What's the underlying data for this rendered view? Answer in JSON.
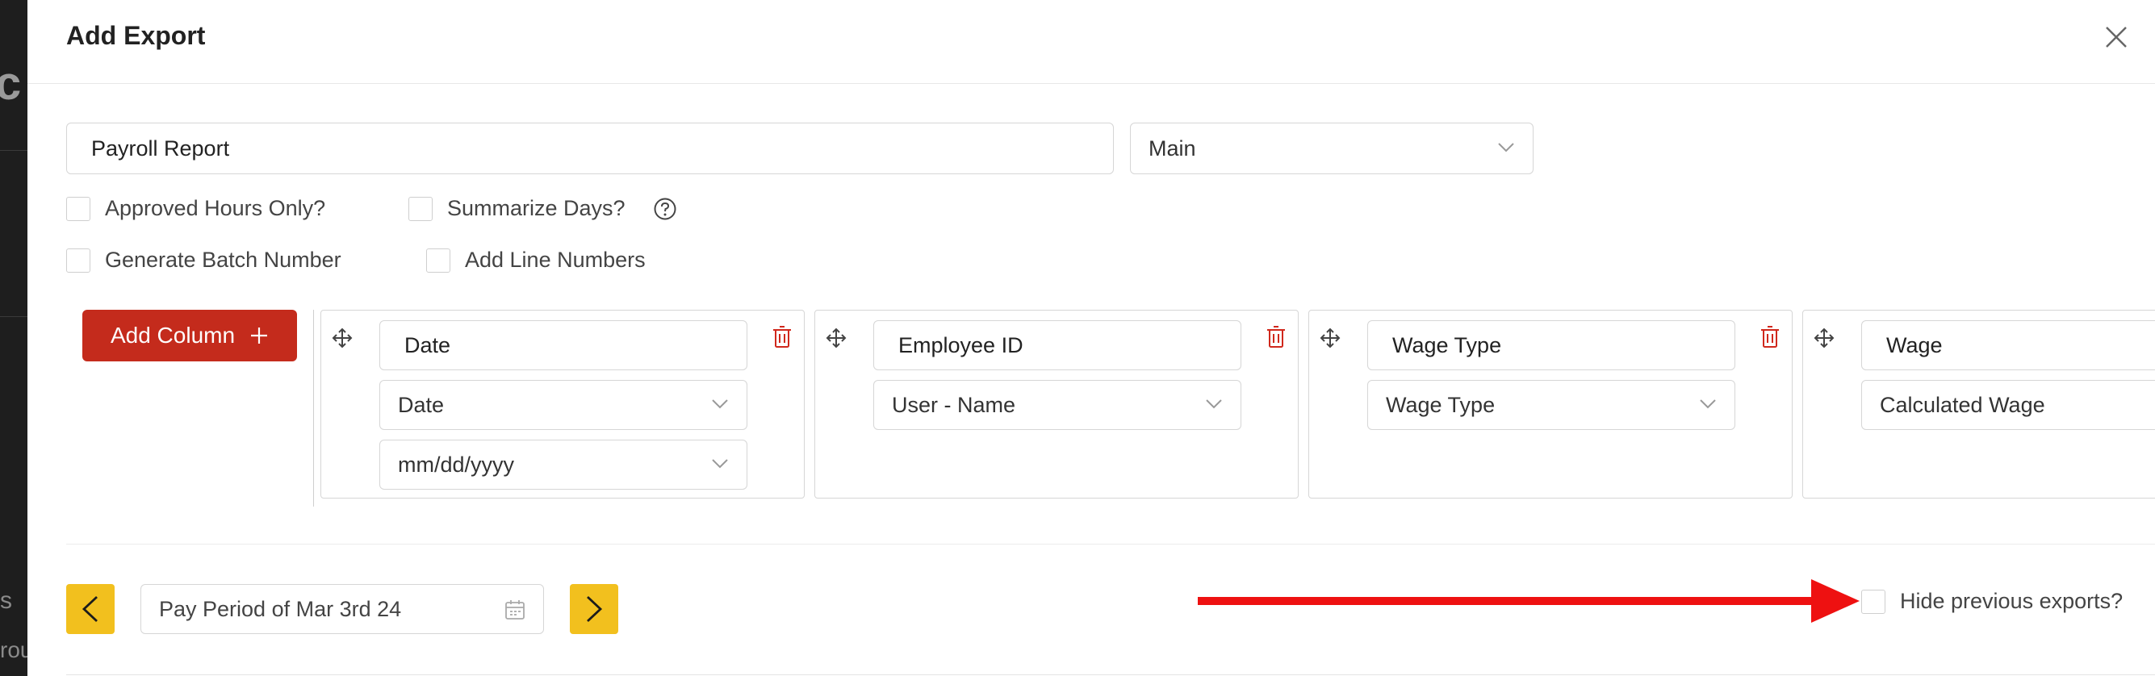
{
  "background": {
    "logo_fragment": "c",
    "fragment_s": "s",
    "fragment_rou": "rou"
  },
  "modal": {
    "title": "Add Export",
    "close_icon": "close-icon"
  },
  "export_form": {
    "name_value": "Payroll Report",
    "template_select": "Main",
    "options": {
      "approved_hours_only": {
        "label": "Approved Hours Only?",
        "checked": false
      },
      "summarize_days": {
        "label": "Summarize Days?",
        "checked": false
      },
      "generate_batch_number": {
        "label": "Generate Batch Number",
        "checked": false
      },
      "add_line_numbers": {
        "label": "Add Line Numbers",
        "checked": false
      }
    },
    "help_icon": "question-circle-icon"
  },
  "add_column_label": "Add Column",
  "columns": [
    {
      "header_value": "Date",
      "field_select": "Date",
      "format_select": "mm/dd/yyyy"
    },
    {
      "header_value": "Employee ID",
      "field_select": "User - Name"
    },
    {
      "header_value": "Wage Type",
      "field_select": "Wage Type"
    },
    {
      "header_value": "Wage",
      "field_select": "Calculated Wage"
    }
  ],
  "period": {
    "value": "Pay Period of Mar 3rd 24",
    "prev_icon": "chevron-left-icon",
    "next_icon": "chevron-right-icon",
    "calendar_icon": "calendar-icon"
  },
  "hide_previous": {
    "label": "Hide previous exports?",
    "checked": false
  },
  "colors": {
    "accent_red": "#c42b1c",
    "nav_yellow": "#f2c01e",
    "annotation_arrow": "#ee1111",
    "trash_red": "#d0281c"
  }
}
